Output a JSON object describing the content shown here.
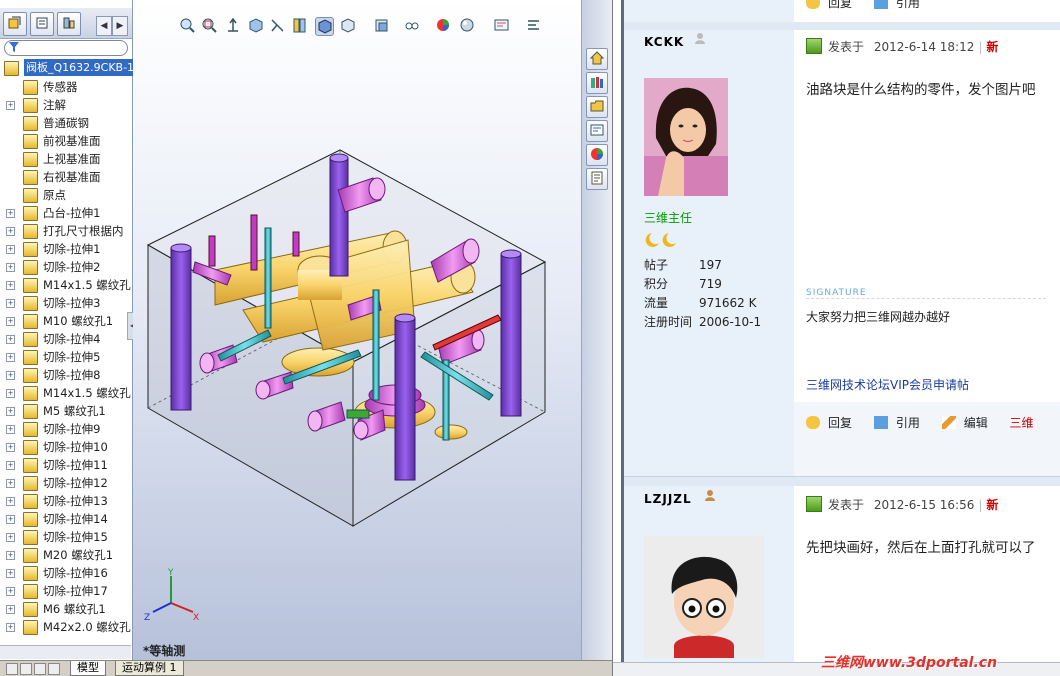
{
  "cad": {
    "root_label": "阀板_Q1632.9CKB-1",
    "tree_items": [
      {
        "label": "传感器",
        "expand": false
      },
      {
        "label": "注解",
        "expand": true
      },
      {
        "label": "普通碳钢",
        "expand": false
      },
      {
        "label": "前视基准面",
        "expand": false
      },
      {
        "label": "上视基准面",
        "expand": false
      },
      {
        "label": "右视基准面",
        "expand": false
      },
      {
        "label": "原点",
        "expand": false
      },
      {
        "label": "凸台-拉伸1",
        "expand": true
      },
      {
        "label": "打孔尺寸根据内",
        "expand": true
      },
      {
        "label": "切除-拉伸1",
        "expand": true
      },
      {
        "label": "切除-拉伸2",
        "expand": true
      },
      {
        "label": "M14x1.5 螺纹孔",
        "expand": true
      },
      {
        "label": "切除-拉伸3",
        "expand": true
      },
      {
        "label": "M10 螺纹孔1",
        "expand": true
      },
      {
        "label": "切除-拉伸4",
        "expand": true
      },
      {
        "label": "切除-拉伸5",
        "expand": true
      },
      {
        "label": "切除-拉伸8",
        "expand": true
      },
      {
        "label": "M14x1.5 螺纹孔",
        "expand": true
      },
      {
        "label": "M5 螺纹孔1",
        "expand": true
      },
      {
        "label": "切除-拉伸9",
        "expand": true
      },
      {
        "label": "切除-拉伸10",
        "expand": true
      },
      {
        "label": "切除-拉伸11",
        "expand": true
      },
      {
        "label": "切除-拉伸12",
        "expand": true
      },
      {
        "label": "切除-拉伸13",
        "expand": true
      },
      {
        "label": "切除-拉伸14",
        "expand": true
      },
      {
        "label": "切除-拉伸15",
        "expand": true
      },
      {
        "label": "M20 螺纹孔1",
        "expand": true
      },
      {
        "label": "切除-拉伸16",
        "expand": true
      },
      {
        "label": "切除-拉伸17",
        "expand": true
      },
      {
        "label": "M6 螺纹孔1",
        "expand": true
      },
      {
        "label": "M42x2.0 螺纹孔",
        "expand": true
      }
    ],
    "view_label": "*等轴测",
    "bottom_tabs": [
      "模型",
      "运动算例 1"
    ],
    "triad": {
      "x": "X",
      "y": "Y",
      "z": "Z"
    },
    "scroll_left": "◀",
    "scroll_right": "▶",
    "splitter_glyph": "◂",
    "expand_glyph": "+",
    "colors": {
      "selection": "#316ac5",
      "body_purple": "#8a4bd6",
      "port_pink": "#d86ad8",
      "manifold_yellow": "#f9d46b",
      "channel_cyan": "#3fc0cc",
      "channel_red": "#e03a3a"
    }
  },
  "forum": {
    "posts": [
      {
        "user": "KCKK",
        "rank": "三维主任",
        "stats": [
          {
            "k": "帖子",
            "v": "197"
          },
          {
            "k": "积分",
            "v": "719"
          },
          {
            "k": "流量",
            "v": "971662 K"
          },
          {
            "k": "注册时间",
            "v": "2006-10-1"
          }
        ],
        "posted_prefix": "发表于",
        "posted_time": "2012-6-14 18:12",
        "sep": "|",
        "new_label": "新",
        "body": "油路块是什么结构的零件，发个图片吧",
        "signature_head": "SIGNATURE",
        "signature": "大家努力把三维网越办越好",
        "vip_link": "三维网技术论坛VIP会员申请帖",
        "actions": [
          "回复",
          "引用",
          "编辑"
        ],
        "extra_action": "三维"
      },
      {
        "user": "LZJJZL",
        "posted_prefix": "发表于",
        "posted_time": "2012-6-15 16:56",
        "sep": "|",
        "new_label": "新",
        "body": "先把块画好，然后在上面打孔就可以了"
      }
    ],
    "top_actions": [
      "回复",
      "引用"
    ],
    "watermark_cn": "三维网",
    "watermark_url": "www.3dportal.cn"
  }
}
